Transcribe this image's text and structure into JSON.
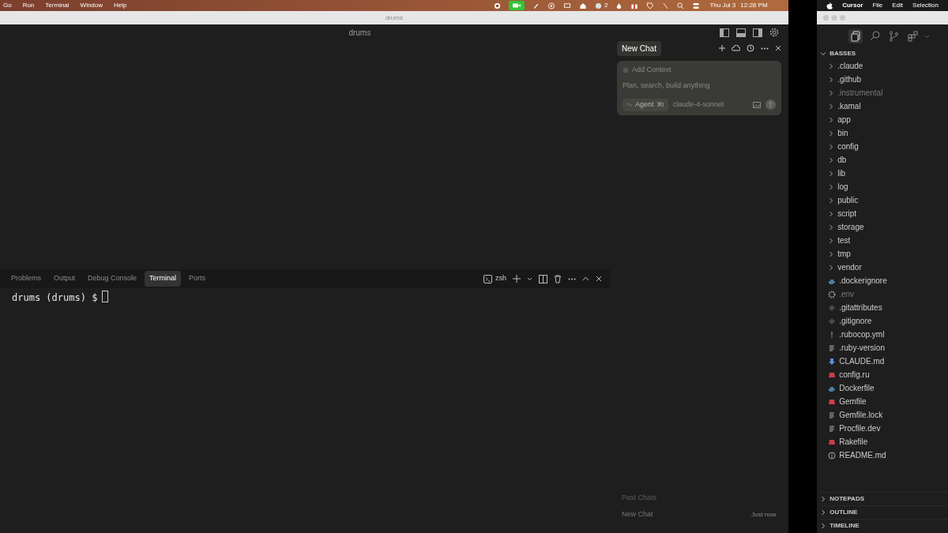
{
  "menubar": {
    "items": [
      "Go",
      "Run",
      "Terminal",
      "Window",
      "Help"
    ],
    "badge_count": "2",
    "date": "Thu Jul 3",
    "time": "12:28 PM"
  },
  "window": {
    "title": "drums",
    "header_title": "drums"
  },
  "panel": {
    "tabs": [
      {
        "label": "Problems",
        "selected": false
      },
      {
        "label": "Output",
        "selected": false
      },
      {
        "label": "Debug Console",
        "selected": false
      },
      {
        "label": "Terminal",
        "selected": true
      },
      {
        "label": "Ports",
        "selected": false
      }
    ],
    "shell": "zsh",
    "prompt": "drums (drums) $"
  },
  "chat": {
    "tab": {
      "label": "New Chat",
      "selected": true
    },
    "add_context": "Add Context",
    "placeholder": "Plan, search, build anything",
    "mode": "Agent",
    "mode_shortcut": "⌘I",
    "model": "claude-4-sonnet",
    "past_chats_heading": "Past Chats",
    "past_chats": [
      {
        "title": "New Chat",
        "time": "Just now"
      }
    ]
  },
  "second_window": {
    "menubar": [
      "Cursor",
      "File",
      "Edit",
      "Selection"
    ],
    "activity": [
      {
        "kind": "files",
        "selected": true
      },
      {
        "kind": "search",
        "selected": false
      },
      {
        "kind": "git",
        "selected": false
      },
      {
        "kind": "extensions",
        "selected": false
      }
    ],
    "explorer": {
      "root": {
        "label": "BASSES",
        "expanded": true
      },
      "items": [
        {
          "kind": "folder",
          "label": ".claude",
          "dimmed": false
        },
        {
          "kind": "folder",
          "label": ".github",
          "dimmed": false
        },
        {
          "kind": "folder",
          "label": ".instrumental",
          "dimmed": true
        },
        {
          "kind": "folder",
          "label": ".kamal",
          "dimmed": false
        },
        {
          "kind": "folder",
          "label": "app",
          "dimmed": false
        },
        {
          "kind": "folder",
          "label": "bin",
          "dimmed": false
        },
        {
          "kind": "folder",
          "label": "config",
          "dimmed": false
        },
        {
          "kind": "folder",
          "label": "db",
          "dimmed": false
        },
        {
          "kind": "folder",
          "label": "lib",
          "dimmed": false
        },
        {
          "kind": "folder",
          "label": "log",
          "dimmed": false
        },
        {
          "kind": "folder",
          "label": "public",
          "dimmed": false
        },
        {
          "kind": "folder",
          "label": "script",
          "dimmed": false
        },
        {
          "kind": "folder",
          "label": "storage",
          "dimmed": false
        },
        {
          "kind": "folder",
          "label": "test",
          "dimmed": false
        },
        {
          "kind": "folder",
          "label": "tmp",
          "dimmed": false
        },
        {
          "kind": "folder",
          "label": "vendor",
          "dimmed": false
        },
        {
          "kind": "docker",
          "label": ".dockerignore",
          "dimmed": false
        },
        {
          "kind": "gear",
          "label": ".env",
          "dimmed": true
        },
        {
          "kind": "git",
          "label": ".gitattributes",
          "dimmed": false
        },
        {
          "kind": "git",
          "label": ".gitignore",
          "dimmed": false
        },
        {
          "kind": "yaml",
          "label": ".rubocop.yml",
          "dimmed": false
        },
        {
          "kind": "text",
          "label": ".ruby-version",
          "dimmed": false
        },
        {
          "kind": "markdown",
          "label": "CLAUDE.md",
          "dimmed": false
        },
        {
          "kind": "ruby",
          "label": "config.ru",
          "dimmed": false
        },
        {
          "kind": "docker",
          "label": "Dockerfile",
          "dimmed": false
        },
        {
          "kind": "ruby",
          "label": "Gemfile",
          "dimmed": false
        },
        {
          "kind": "text",
          "label": "Gemfile.lock",
          "dimmed": false
        },
        {
          "kind": "text",
          "label": "Procfile.dev",
          "dimmed": false
        },
        {
          "kind": "ruby",
          "label": "Rakefile",
          "dimmed": false
        },
        {
          "kind": "info",
          "label": "README.md",
          "dimmed": false
        }
      ],
      "sections": [
        {
          "label": "NOTEPADS",
          "expanded": false
        },
        {
          "label": "OUTLINE",
          "expanded": false
        },
        {
          "label": "TIMELINE",
          "expanded": false
        }
      ]
    }
  }
}
